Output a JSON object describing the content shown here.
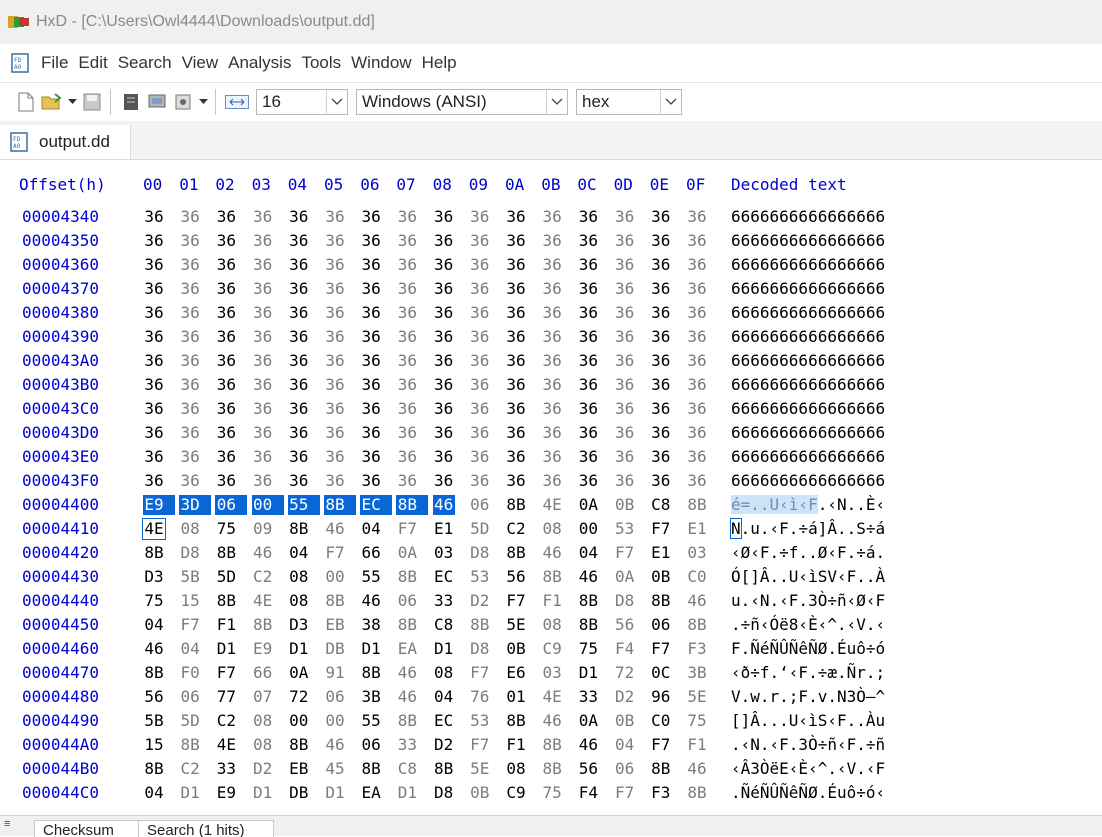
{
  "window": {
    "title": "HxD - [C:\\Users\\Owl4444\\Downloads\\output.dd]"
  },
  "menu": [
    "File",
    "Edit",
    "Search",
    "View",
    "Analysis",
    "Tools",
    "Window",
    "Help"
  ],
  "toolbar": {
    "icons": [
      "new-file-icon",
      "open-file-icon",
      "dropdown-icon",
      "save-icon",
      "view-icon",
      "ram-icon",
      "disk-icon",
      "dropdown-icon",
      "bytes-per-row-icon"
    ],
    "bytes_per_row": "16",
    "charset": "Windows (ANSI)",
    "offset_base": "hex"
  },
  "tab": {
    "label": "output.dd"
  },
  "hex": {
    "offset_header": "Offset(h)",
    "column_headers": [
      "00",
      "01",
      "02",
      "03",
      "04",
      "05",
      "06",
      "07",
      "08",
      "09",
      "0A",
      "0B",
      "0C",
      "0D",
      "0E",
      "0F"
    ],
    "decoded_header": "Decoded text",
    "rows": [
      {
        "offset": "00004340",
        "bytes": [
          "36",
          "36",
          "36",
          "36",
          "36",
          "36",
          "36",
          "36",
          "36",
          "36",
          "36",
          "36",
          "36",
          "36",
          "36",
          "36"
        ],
        "text": "6666666666666666"
      },
      {
        "offset": "00004350",
        "bytes": [
          "36",
          "36",
          "36",
          "36",
          "36",
          "36",
          "36",
          "36",
          "36",
          "36",
          "36",
          "36",
          "36",
          "36",
          "36",
          "36"
        ],
        "text": "6666666666666666"
      },
      {
        "offset": "00004360",
        "bytes": [
          "36",
          "36",
          "36",
          "36",
          "36",
          "36",
          "36",
          "36",
          "36",
          "36",
          "36",
          "36",
          "36",
          "36",
          "36",
          "36"
        ],
        "text": "6666666666666666"
      },
      {
        "offset": "00004370",
        "bytes": [
          "36",
          "36",
          "36",
          "36",
          "36",
          "36",
          "36",
          "36",
          "36",
          "36",
          "36",
          "36",
          "36",
          "36",
          "36",
          "36"
        ],
        "text": "6666666666666666"
      },
      {
        "offset": "00004380",
        "bytes": [
          "36",
          "36",
          "36",
          "36",
          "36",
          "36",
          "36",
          "36",
          "36",
          "36",
          "36",
          "36",
          "36",
          "36",
          "36",
          "36"
        ],
        "text": "6666666666666666"
      },
      {
        "offset": "00004390",
        "bytes": [
          "36",
          "36",
          "36",
          "36",
          "36",
          "36",
          "36",
          "36",
          "36",
          "36",
          "36",
          "36",
          "36",
          "36",
          "36",
          "36"
        ],
        "text": "6666666666666666"
      },
      {
        "offset": "000043A0",
        "bytes": [
          "36",
          "36",
          "36",
          "36",
          "36",
          "36",
          "36",
          "36",
          "36",
          "36",
          "36",
          "36",
          "36",
          "36",
          "36",
          "36"
        ],
        "text": "6666666666666666"
      },
      {
        "offset": "000043B0",
        "bytes": [
          "36",
          "36",
          "36",
          "36",
          "36",
          "36",
          "36",
          "36",
          "36",
          "36",
          "36",
          "36",
          "36",
          "36",
          "36",
          "36"
        ],
        "text": "6666666666666666"
      },
      {
        "offset": "000043C0",
        "bytes": [
          "36",
          "36",
          "36",
          "36",
          "36",
          "36",
          "36",
          "36",
          "36",
          "36",
          "36",
          "36",
          "36",
          "36",
          "36",
          "36"
        ],
        "text": "6666666666666666"
      },
      {
        "offset": "000043D0",
        "bytes": [
          "36",
          "36",
          "36",
          "36",
          "36",
          "36",
          "36",
          "36",
          "36",
          "36",
          "36",
          "36",
          "36",
          "36",
          "36",
          "36"
        ],
        "text": "6666666666666666"
      },
      {
        "offset": "000043E0",
        "bytes": [
          "36",
          "36",
          "36",
          "36",
          "36",
          "36",
          "36",
          "36",
          "36",
          "36",
          "36",
          "36",
          "36",
          "36",
          "36",
          "36"
        ],
        "text": "6666666666666666"
      },
      {
        "offset": "000043F0",
        "bytes": [
          "36",
          "36",
          "36",
          "36",
          "36",
          "36",
          "36",
          "36",
          "36",
          "36",
          "36",
          "36",
          "36",
          "36",
          "36",
          "36"
        ],
        "text": "6666666666666666"
      },
      {
        "offset": "00004400",
        "bytes": [
          "E9",
          "3D",
          "06",
          "00",
          "55",
          "8B",
          "EC",
          "8B",
          "46",
          "06",
          "8B",
          "4E",
          "0A",
          "0B",
          "C8",
          "8B"
        ],
        "text": "é=..U‹ì‹F.‹N..È‹"
      },
      {
        "offset": "00004410",
        "bytes": [
          "4E",
          "08",
          "75",
          "09",
          "8B",
          "46",
          "04",
          "F7",
          "E1",
          "5D",
          "C2",
          "08",
          "00",
          "53",
          "F7",
          "E1"
        ],
        "text": "N.u.‹F.÷á]Â..S÷á"
      },
      {
        "offset": "00004420",
        "bytes": [
          "8B",
          "D8",
          "8B",
          "46",
          "04",
          "F7",
          "66",
          "0A",
          "03",
          "D8",
          "8B",
          "46",
          "04",
          "F7",
          "E1",
          "03"
        ],
        "text": "‹Ø‹F.÷f..Ø‹F.÷á."
      },
      {
        "offset": "00004430",
        "bytes": [
          "D3",
          "5B",
          "5D",
          "C2",
          "08",
          "00",
          "55",
          "8B",
          "EC",
          "53",
          "56",
          "8B",
          "46",
          "0A",
          "0B",
          "C0"
        ],
        "text": "Ó[]Â..U‹ìSV‹F..À"
      },
      {
        "offset": "00004440",
        "bytes": [
          "75",
          "15",
          "8B",
          "4E",
          "08",
          "8B",
          "46",
          "06",
          "33",
          "D2",
          "F7",
          "F1",
          "8B",
          "D8",
          "8B",
          "46"
        ],
        "text": "u.‹N.‹F.3Ò÷ñ‹Ø‹F"
      },
      {
        "offset": "00004450",
        "bytes": [
          "04",
          "F7",
          "F1",
          "8B",
          "D3",
          "EB",
          "38",
          "8B",
          "C8",
          "8B",
          "5E",
          "08",
          "8B",
          "56",
          "06",
          "8B"
        ],
        "text": ".÷ñ‹Óë8‹È‹^.‹V.‹"
      },
      {
        "offset": "00004460",
        "bytes": [
          "46",
          "04",
          "D1",
          "E9",
          "D1",
          "DB",
          "D1",
          "EA",
          "D1",
          "D8",
          "0B",
          "C9",
          "75",
          "F4",
          "F7",
          "F3"
        ],
        "text": "F.ÑéÑÛÑêÑØ.Éuô÷ó"
      },
      {
        "offset": "00004470",
        "bytes": [
          "8B",
          "F0",
          "F7",
          "66",
          "0A",
          "91",
          "8B",
          "46",
          "08",
          "F7",
          "E6",
          "03",
          "D1",
          "72",
          "0C",
          "3B"
        ],
        "text": "‹ð÷f.‘‹F.÷æ.Ñr.;"
      },
      {
        "offset": "00004480",
        "bytes": [
          "56",
          "06",
          "77",
          "07",
          "72",
          "06",
          "3B",
          "46",
          "04",
          "76",
          "01",
          "4E",
          "33",
          "D2",
          "96",
          "5E"
        ],
        "text": "V.w.r.;F.v.N3Ò–^"
      },
      {
        "offset": "00004490",
        "bytes": [
          "5B",
          "5D",
          "C2",
          "08",
          "00",
          "00",
          "55",
          "8B",
          "EC",
          "53",
          "8B",
          "46",
          "0A",
          "0B",
          "C0",
          "75"
        ],
        "text": "[]Â...U‹ìS‹F..Àu"
      },
      {
        "offset": "000044A0",
        "bytes": [
          "15",
          "8B",
          "4E",
          "08",
          "8B",
          "46",
          "06",
          "33",
          "D2",
          "F7",
          "F1",
          "8B",
          "46",
          "04",
          "F7",
          "F1"
        ],
        "text": ".‹N.‹F.3Ò÷ñ‹F.÷ñ"
      },
      {
        "offset": "000044B0",
        "bytes": [
          "8B",
          "C2",
          "33",
          "D2",
          "EB",
          "45",
          "8B",
          "C8",
          "8B",
          "5E",
          "08",
          "8B",
          "56",
          "06",
          "8B",
          "46"
        ],
        "text": "‹Â3ÒëE‹È‹^.‹V.‹F"
      },
      {
        "offset": "000044C0",
        "bytes": [
          "04",
          "D1",
          "E9",
          "D1",
          "DB",
          "D1",
          "EA",
          "D1",
          "D8",
          "0B",
          "C9",
          "75",
          "F4",
          "F7",
          "F3",
          "8B"
        ],
        "text": ".ÑéÑÛÑêÑØ.Éuô÷ó‹"
      }
    ]
  },
  "bottom_tabs": [
    "Checksum",
    "Search (1 hits)"
  ],
  "colors": {
    "offset": "#0000d0",
    "selection": "#0a66d6",
    "alt_column": "#7c7c7c"
  }
}
